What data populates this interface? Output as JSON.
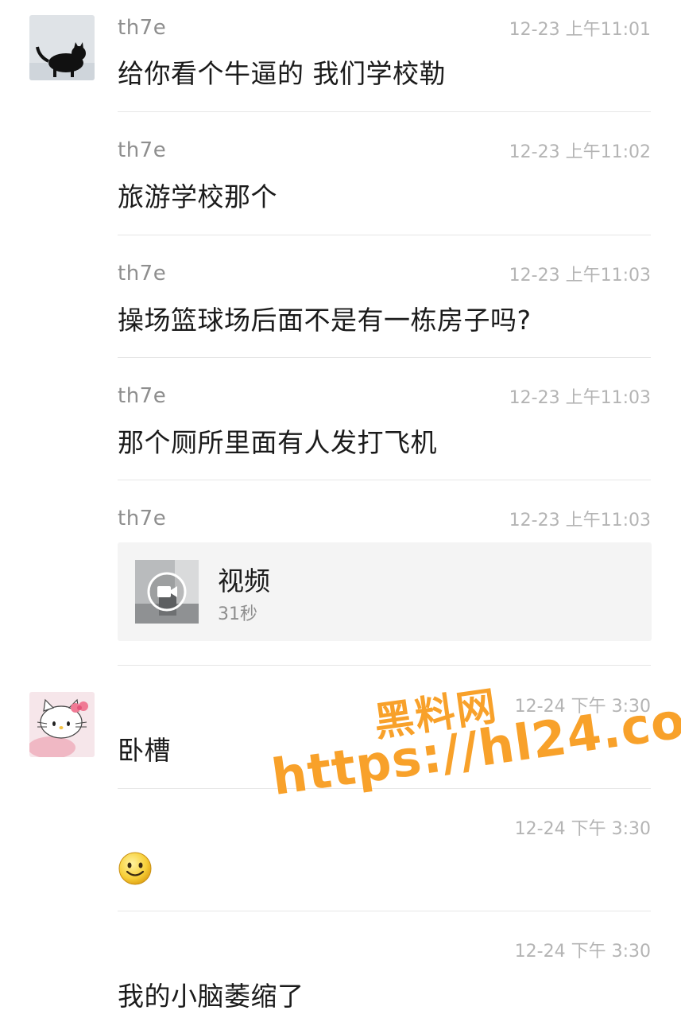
{
  "messages": [
    {
      "sender": "th7e",
      "time": "12-23 上午11:01",
      "text": "给你看个牛逼的 我们学校勒"
    },
    {
      "sender": "th7e",
      "time": "12-23 上午11:02",
      "text": "旅游学校那个"
    },
    {
      "sender": "th7e",
      "time": "12-23 上午11:03",
      "text": "操场篮球场后面不是有一栋房子吗?"
    },
    {
      "sender": "th7e",
      "time": "12-23 上午11:03",
      "text": "那个厕所里面有人发打飞机"
    },
    {
      "sender": "th7e",
      "time": "12-23 上午11:03",
      "video": {
        "title": "视频",
        "duration": "31秒"
      }
    },
    {
      "sender": "",
      "time": "12-24 下午 3:30",
      "text": "卧槽"
    },
    {
      "sender": "",
      "time": "12-24 下午 3:30",
      "emoji": "smile-emoji"
    },
    {
      "sender": "",
      "time": "12-24 下午 3:30",
      "text": "我的小脑萎缩了"
    }
  ],
  "watermark": {
    "line1": "黑料网",
    "line2": "https://hl24.co",
    "color": "#f8a12a"
  },
  "colors": {
    "sender": "#8e8e8e",
    "time": "#b4b4b4",
    "text": "#1b1b1b",
    "divider": "#e6e6e6",
    "card": "#f4f4f4"
  }
}
